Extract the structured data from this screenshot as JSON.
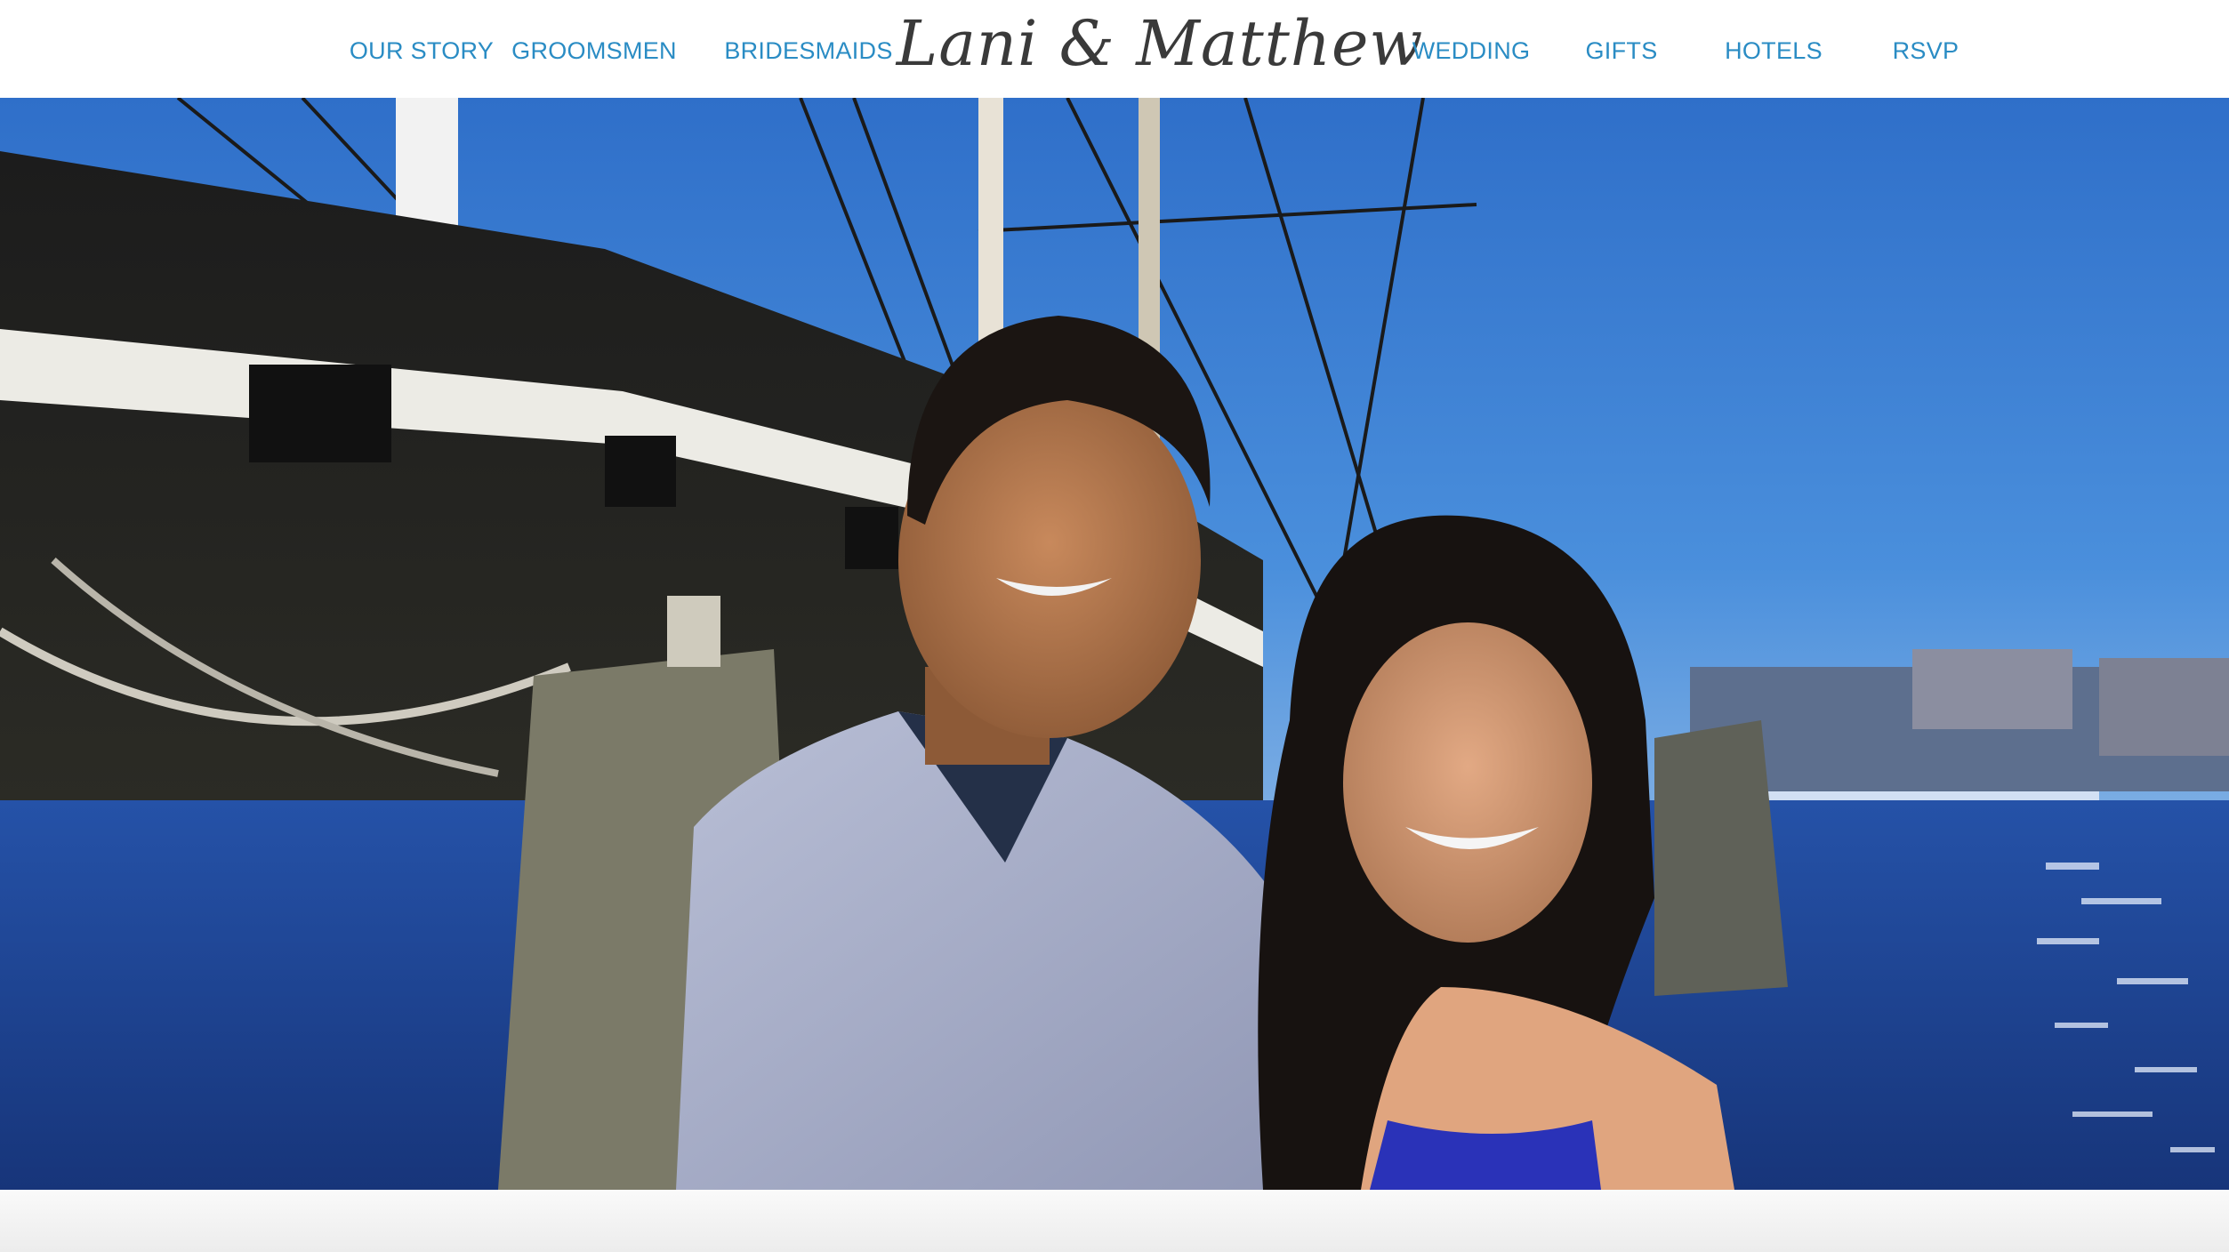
{
  "header": {
    "brand_title": "Lani & Matthew",
    "nav_left": [
      {
        "label": "OUR STORY"
      },
      {
        "label": "GROOMSMEN"
      },
      {
        "label": "BRIDESMAIDS"
      }
    ],
    "nav_right": [
      {
        "label": "WEDDING"
      },
      {
        "label": "GIFTS"
      },
      {
        "label": "HOTELS"
      },
      {
        "label": "RSVP"
      }
    ]
  },
  "colors": {
    "nav_link": "#2a8cc4",
    "brand_text": "#3a3a3a",
    "sky": "#3b7fd0",
    "water": "#1f4fa8"
  },
  "hero": {
    "image_subject": "couple-photo-harbor-tall-ship"
  }
}
